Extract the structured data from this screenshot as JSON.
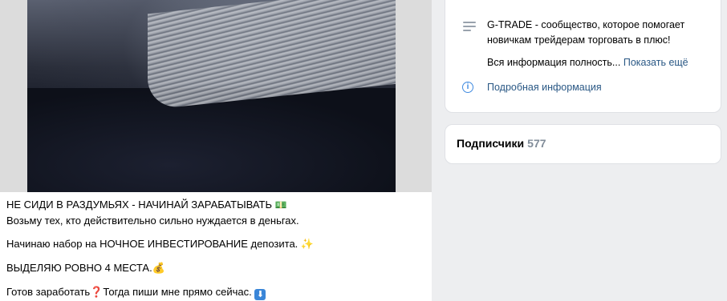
{
  "post": {
    "line1": "НЕ СИДИ В РАЗДУМЬЯХ - НАЧИНАЙ ЗАРАБАТЫВАТЬ",
    "line1_emoji": "💵",
    "line2": "Возьму тех, кто действительно сильно нуждается в деньгах.",
    "line3": "Начинаю набор на НОЧНОЕ ИНВЕСТИРОВАНИЕ депозита.",
    "line3_emoji": "✨",
    "line4": "ВЫДЕЛЯЮ РОВНО 4 МЕСТА.",
    "line4_emoji": "💰",
    "line5_a": "Готов заработать",
    "line5_q": "❓",
    "line5_b": "Тогда пиши мне прямо сейчас.",
    "line5_emoji": "⬇"
  },
  "info": {
    "description": "G-TRADE - сообщество, которое помогает новичкам трейдерам торговать в плюс!",
    "more_text": "Вся информация полность...",
    "show_more": "Показать ещё",
    "details": "Подробная информация",
    "details_icon": "info-circle-icon",
    "lines_icon": "description-lines-icon"
  },
  "subscribers": {
    "label": "Подписчики",
    "count": "577"
  },
  "colors": {
    "link": "#2a5885",
    "accent": "#3f8ae0",
    "muted": "#818c99",
    "background": "#edeef0"
  }
}
